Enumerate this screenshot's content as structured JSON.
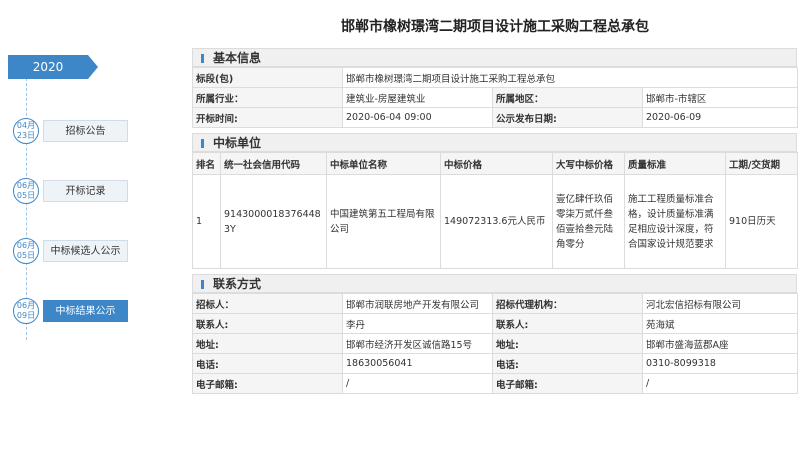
{
  "title": "邯郸市橡树璟湾二期项目设计施工采购工程总承包",
  "timeline": {
    "year": "2020",
    "items": [
      {
        "month": "04月",
        "day": "23日",
        "label": "招标公告",
        "active": false
      },
      {
        "month": "06月",
        "day": "05日",
        "label": "开标记录",
        "active": false
      },
      {
        "month": "06月",
        "day": "05日",
        "label": "中标候选人公示",
        "active": false
      },
      {
        "month": "06月",
        "day": "09日",
        "label": "中标结果公示",
        "active": true
      }
    ]
  },
  "basic": {
    "heading": "基本信息",
    "section_label": "标段(包)",
    "section_value": "邯郸市橡树璟湾二期项目设计施工采购工程总承包",
    "industry_label": "所属行业：",
    "industry_value": "建筑业-房屋建筑业",
    "region_label": "所属地区：",
    "region_value": "邯郸市-市辖区",
    "open_time_label": "开标时间:",
    "open_time_value": "2020-06-04 09:00",
    "publish_label": "公示发布日期:",
    "publish_value": "2020-06-09"
  },
  "winner": {
    "heading": "中标单位",
    "headers": [
      "排名",
      "统一社会信用代码",
      "中标单位名称",
      "中标价格",
      "大写中标价格",
      "质量标准",
      "工期/交货期"
    ],
    "rows": [
      {
        "rank": "1",
        "credit_code": "91430000183764483Y",
        "name": "中国建筑第五工程局有限公司",
        "price": "149072313.6元人民币",
        "price_upper": "壹亿肆仟玖佰零柒万贰仟叁佰壹拾叁元陆角零分",
        "quality": "施工工程质量标准合格，设计质量标准满足相应设计深度，符合国家设计规范要求",
        "period": "910日历天"
      }
    ]
  },
  "contact": {
    "heading": "联系方式",
    "tenderer_label": "招标人：",
    "tenderer_value": "邯郸市润联房地产开发有限公司",
    "agency_label": "招标代理机构：",
    "agency_value": "河北宏信招标有限公司",
    "contact1_label": "联系人:",
    "contact1_value": "李丹",
    "contact2_label": "联系人:",
    "contact2_value": "苑海斌",
    "addr1_label": "地址:",
    "addr1_value": "邯郸市经济开发区诚信路15号",
    "addr2_label": "地址:",
    "addr2_value": "邯郸市盛海蓝郡A座",
    "phone1_label": "电话:",
    "phone1_value": "18630056041",
    "phone2_label": "电话:",
    "phone2_value": "0310-8099318",
    "email1_label": "电子邮箱:",
    "email1_value": "/",
    "email2_label": "电子邮箱:",
    "email2_value": "/"
  }
}
